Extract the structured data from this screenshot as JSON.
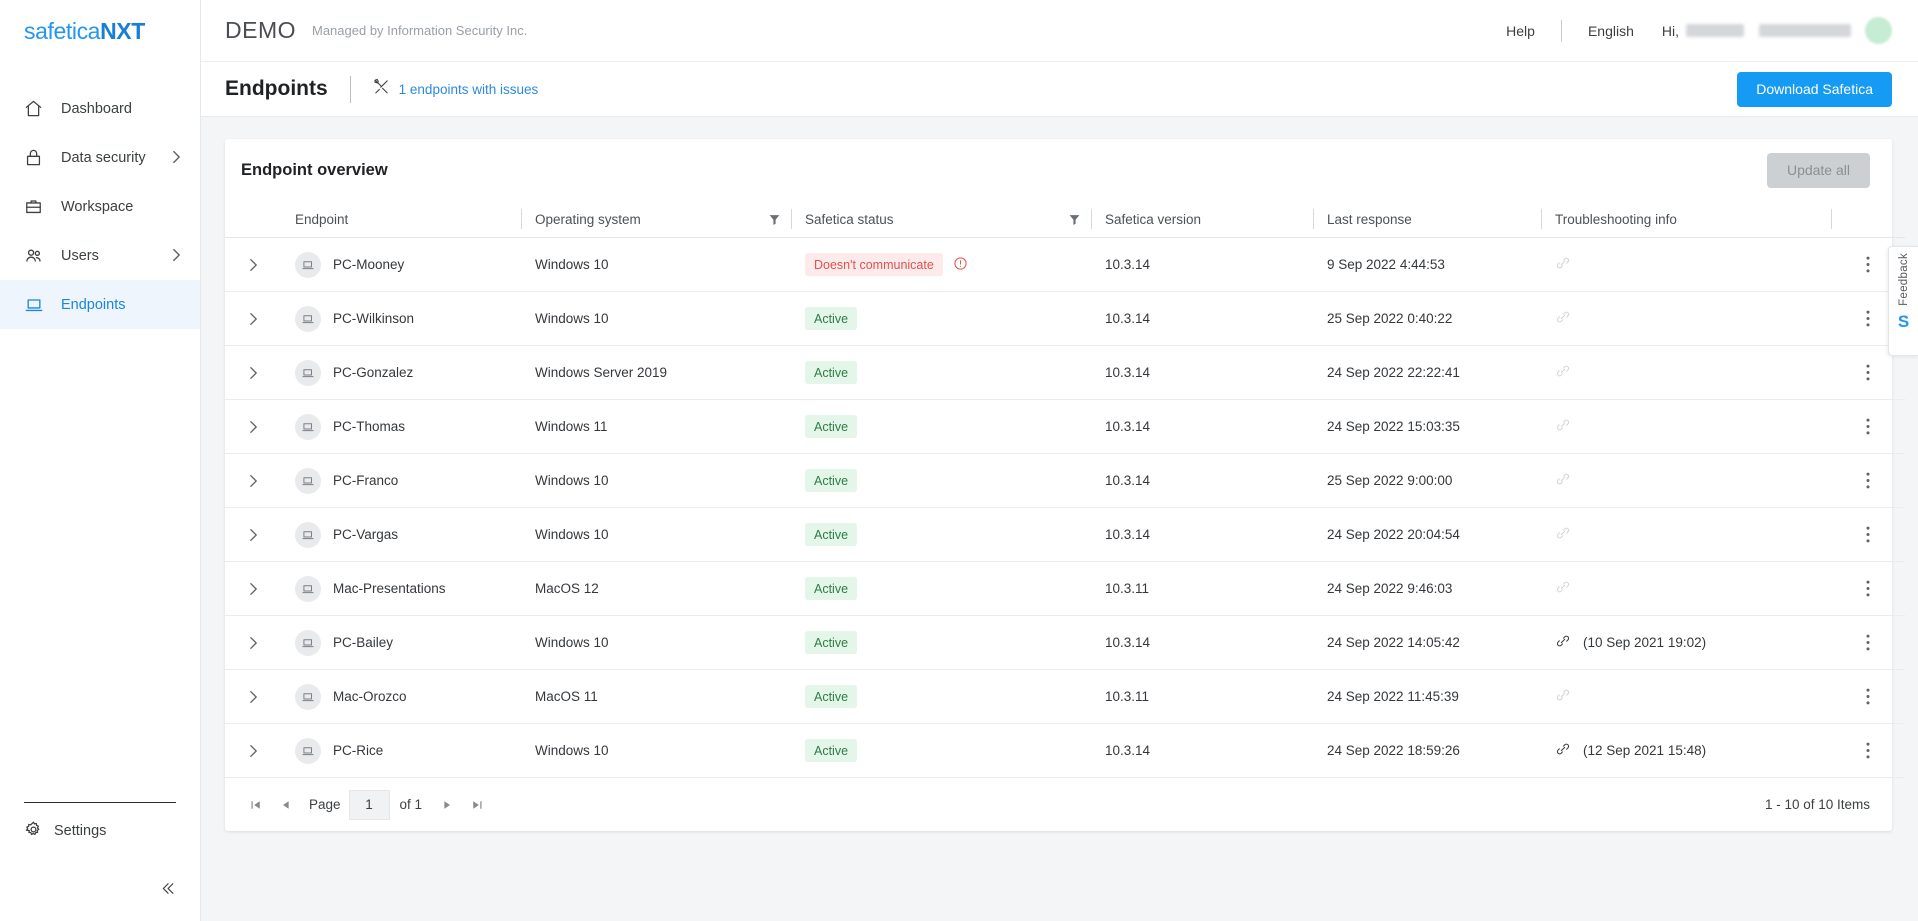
{
  "brand": {
    "name_thin": "safetica",
    "name_bold": "NXT"
  },
  "sidebar": {
    "items": [
      {
        "label": "Dashboard",
        "icon": "home-icon",
        "has_chevron": false
      },
      {
        "label": "Data security",
        "icon": "lock-icon",
        "has_chevron": true
      },
      {
        "label": "Workspace",
        "icon": "briefcase-icon",
        "has_chevron": false
      },
      {
        "label": "Users",
        "icon": "users-icon",
        "has_chevron": true
      },
      {
        "label": "Endpoints",
        "icon": "laptop-icon",
        "has_chevron": false
      }
    ],
    "settings_label": "Settings",
    "collapse_icon": "chevron-double-left-icon"
  },
  "topbar": {
    "tenant": "DEMO",
    "managed_by": "Managed by Information Security Inc.",
    "help_label": "Help",
    "language_label": "English",
    "greeting": "Hi,"
  },
  "pagebar": {
    "title": "Endpoints",
    "issues_icon": "tools-icon",
    "issues_text": "1 endpoints with issues",
    "download_label": "Download Safetica"
  },
  "card": {
    "title": "Endpoint overview",
    "update_all_label": "Update all"
  },
  "table": {
    "columns": [
      {
        "label": "Endpoint",
        "filter": false
      },
      {
        "label": "Operating system",
        "filter": true
      },
      {
        "label": "Safetica status",
        "filter": true
      },
      {
        "label": "Safetica version",
        "filter": false
      },
      {
        "label": "Last response",
        "filter": false
      },
      {
        "label": "Troubleshooting info",
        "filter": false
      }
    ],
    "rows": [
      {
        "endpoint": "PC-Mooney",
        "os": "Windows 10",
        "status": "Doesn't communicate",
        "status_type": "err",
        "warn": true,
        "version": "10.3.14",
        "last_response": "9 Sep 2022 4:44:53",
        "link_active": false,
        "trouble": ""
      },
      {
        "endpoint": "PC-Wilkinson",
        "os": "Windows 10",
        "status": "Active",
        "status_type": "active",
        "warn": false,
        "version": "10.3.14",
        "last_response": "25 Sep 2022 0:40:22",
        "link_active": false,
        "trouble": ""
      },
      {
        "endpoint": "PC-Gonzalez",
        "os": "Windows Server 2019",
        "status": "Active",
        "status_type": "active",
        "warn": false,
        "version": "10.3.14",
        "last_response": "24 Sep 2022 22:22:41",
        "link_active": false,
        "trouble": ""
      },
      {
        "endpoint": "PC-Thomas",
        "os": "Windows 11",
        "status": "Active",
        "status_type": "active",
        "warn": false,
        "version": "10.3.14",
        "last_response": "24 Sep 2022 15:03:35",
        "link_active": false,
        "trouble": ""
      },
      {
        "endpoint": "PC-Franco",
        "os": "Windows 10",
        "status": "Active",
        "status_type": "active",
        "warn": false,
        "version": "10.3.14",
        "last_response": "25 Sep 2022 9:00:00",
        "link_active": false,
        "trouble": ""
      },
      {
        "endpoint": "PC-Vargas",
        "os": "Windows 10",
        "status": "Active",
        "status_type": "active",
        "warn": false,
        "version": "10.3.14",
        "last_response": "24 Sep 2022 20:04:54",
        "link_active": false,
        "trouble": ""
      },
      {
        "endpoint": "Mac-Presentations",
        "os": "MacOS 12",
        "status": "Active",
        "status_type": "active",
        "warn": false,
        "version": "10.3.11",
        "last_response": "24 Sep 2022 9:46:03",
        "link_active": false,
        "trouble": ""
      },
      {
        "endpoint": "PC-Bailey",
        "os": "Windows 10",
        "status": "Active",
        "status_type": "active",
        "warn": false,
        "version": "10.3.14",
        "last_response": "24 Sep 2022 14:05:42",
        "link_active": true,
        "trouble": "(10 Sep 2021 19:02)"
      },
      {
        "endpoint": "Mac-Orozco",
        "os": "MacOS 11",
        "status": "Active",
        "status_type": "active",
        "warn": false,
        "version": "10.3.11",
        "last_response": "24 Sep 2022 11:45:39",
        "link_active": false,
        "trouble": ""
      },
      {
        "endpoint": "PC-Rice",
        "os": "Windows 10",
        "status": "Active",
        "status_type": "active",
        "warn": false,
        "version": "10.3.14",
        "last_response": "24 Sep 2022 18:59:26",
        "link_active": true,
        "trouble": "(12 Sep 2021 15:48)"
      }
    ]
  },
  "pagination": {
    "first_icon": "first-page-icon",
    "prev_icon": "prev-page-icon",
    "page_label": "Page",
    "page_value": "1",
    "of_label": "of 1",
    "next_icon": "next-page-icon",
    "last_icon": "last-page-icon",
    "range_text": "1 - 10 of 10 Items"
  },
  "feedback": {
    "label": "Feedback",
    "logo": "S"
  },
  "colors": {
    "accent": "#159bf3",
    "brand_blue": "#2196f3",
    "active_badge_bg": "#e4f5e9",
    "active_badge_text": "#2e7d46",
    "error_badge_bg": "#fdebeb",
    "error_badge_text": "#e0524d",
    "nav_active_bg": "#eef5fd",
    "page_bg": "#f4f5f7"
  }
}
